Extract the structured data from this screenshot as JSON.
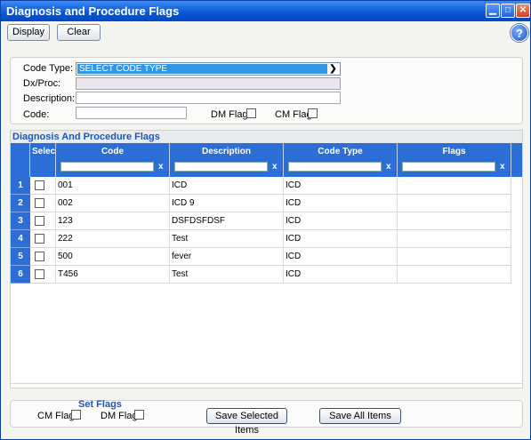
{
  "window": {
    "title": "Diagnosis and Procedure Flags",
    "controls": {
      "minimize": "▁",
      "maximize": "□",
      "close": "✕"
    }
  },
  "toolbar": {
    "display_label": "Display",
    "clear_label": "Clear",
    "help_label": "?"
  },
  "filters": {
    "code_type_label": "Code Type:",
    "code_type_value": "SELECT CODE TYPE",
    "dxproc_label": "Dx/Proc:",
    "description_label": "Description:",
    "code_label": "Code:",
    "dm_flag_label": "DM Flag",
    "cm_flag_label": "CM Flag"
  },
  "grid": {
    "caption": "Diagnosis And Procedure Flags",
    "columns": {
      "select": "Selec",
      "code": "Code",
      "description": "Description",
      "code_type": "Code Type",
      "flags": "Flags"
    },
    "filter_clear": "x",
    "rows": [
      {
        "num": "1",
        "code": "001",
        "description": "ICD",
        "code_type": "ICD",
        "flags": ""
      },
      {
        "num": "2",
        "code": "002",
        "description": "ICD 9",
        "code_type": "ICD",
        "flags": ""
      },
      {
        "num": "3",
        "code": "123",
        "description": "DSFDSFDSF",
        "code_type": "ICD",
        "flags": ""
      },
      {
        "num": "4",
        "code": "222",
        "description": "Test",
        "code_type": "ICD",
        "flags": ""
      },
      {
        "num": "5",
        "code": "500",
        "description": "fever",
        "code_type": "ICD",
        "flags": ""
      },
      {
        "num": "6",
        "code": "T456",
        "description": "Test",
        "code_type": "ICD",
        "flags": ""
      }
    ]
  },
  "set_flags": {
    "title": "Set Flags",
    "cm_flag_label": "CM Flag",
    "dm_flag_label": "DM Flag",
    "save_selected_label": "Save Selected Items",
    "save_all_label": "Save All Items"
  },
  "colors": {
    "accent": "#2b6fd6",
    "titlebar": "#0a59d8",
    "section_title": "#1f56b4"
  }
}
